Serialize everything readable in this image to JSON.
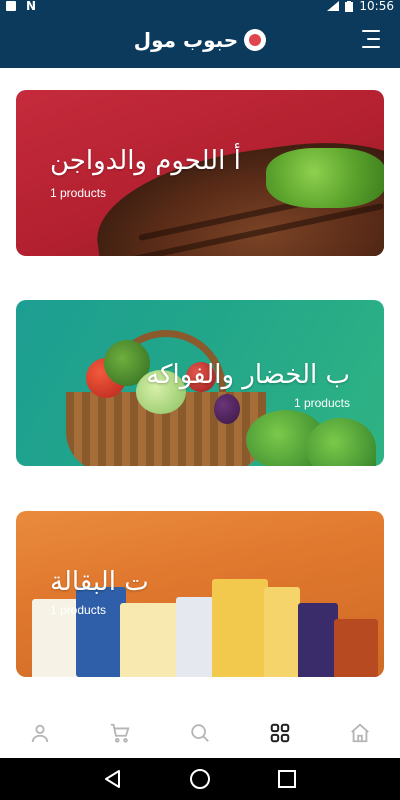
{
  "status_bar": {
    "time": "10:56",
    "background": "#0c3a5c"
  },
  "app_bar": {
    "title": "حبوب مول",
    "background": "#0c3a5c",
    "icons": [
      "brand-logo-icon",
      "hamburger-menu-icon"
    ]
  },
  "categories": [
    {
      "title": "أ اللحوم والدواجن",
      "count_label": "1 products",
      "color": "#c52b3c"
    },
    {
      "title": "ب الخضار والفواكه",
      "count_label": "1 products",
      "color": "#22a68a"
    },
    {
      "title": "ت البقالة",
      "count_label": "1 products",
      "color": "#e0782e"
    }
  ],
  "bottom_nav": {
    "items": [
      {
        "icon": "person-icon",
        "active": false
      },
      {
        "icon": "cart-icon",
        "active": false
      },
      {
        "icon": "search-icon",
        "active": false
      },
      {
        "icon": "grid-icon",
        "active": true
      },
      {
        "icon": "home-icon",
        "active": false
      }
    ],
    "active_color": "#222222",
    "inactive_color": "#b5b5b5"
  },
  "system_nav": {
    "icons": [
      "back-icon",
      "home-circle-icon",
      "recents-icon"
    ]
  }
}
